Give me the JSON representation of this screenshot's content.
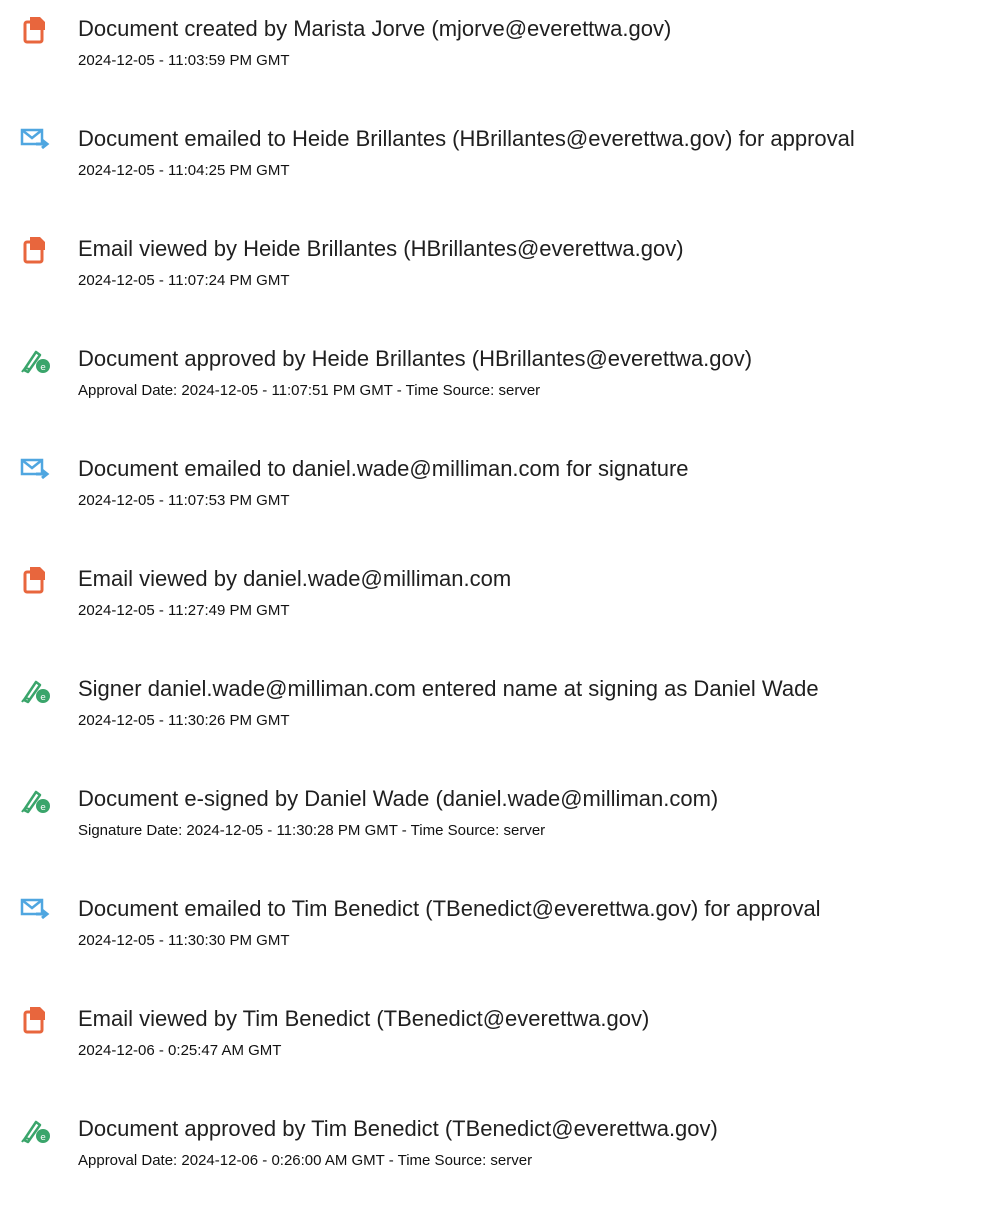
{
  "audit_trail": {
    "colors": {
      "doc_icon": "#e8663d",
      "email_icon": "#4fa6e0",
      "sign_icon": "#3aa56b"
    },
    "events": [
      {
        "icon": "document-icon",
        "title": "Document created by Marista Jorve (mjorve@everettwa.gov)",
        "meta": "2024-12-05 - 11:03:59 PM GMT"
      },
      {
        "icon": "email-sent-icon",
        "title": "Document emailed to Heide Brillantes (HBrillantes@everettwa.gov) for approval",
        "meta": "2024-12-05 - 11:04:25 PM GMT"
      },
      {
        "icon": "document-icon",
        "title": "Email viewed by Heide Brillantes (HBrillantes@everettwa.gov)",
        "meta": "2024-12-05 - 11:07:24 PM GMT"
      },
      {
        "icon": "e-sign-pen-icon",
        "title": "Document approved by Heide Brillantes (HBrillantes@everettwa.gov)",
        "meta": "Approval Date: 2024-12-05 - 11:07:51 PM GMT - Time Source: server"
      },
      {
        "icon": "email-sent-icon",
        "title": "Document emailed to daniel.wade@milliman.com for signature",
        "meta": "2024-12-05 - 11:07:53 PM GMT"
      },
      {
        "icon": "document-icon",
        "title": "Email viewed by daniel.wade@milliman.com",
        "meta": "2024-12-05 - 11:27:49 PM GMT"
      },
      {
        "icon": "e-sign-pen-icon",
        "title": "Signer daniel.wade@milliman.com entered name at signing as Daniel Wade",
        "meta": "2024-12-05 - 11:30:26 PM GMT"
      },
      {
        "icon": "e-sign-pen-icon",
        "title": "Document e-signed by Daniel Wade (daniel.wade@milliman.com)",
        "meta": "Signature Date: 2024-12-05 - 11:30:28 PM GMT - Time Source: server"
      },
      {
        "icon": "email-sent-icon",
        "title": "Document emailed to Tim Benedict (TBenedict@everettwa.gov) for approval",
        "meta": "2024-12-05 - 11:30:30 PM GMT"
      },
      {
        "icon": "document-icon",
        "title": "Email viewed by Tim Benedict (TBenedict@everettwa.gov)",
        "meta": "2024-12-06 - 0:25:47 AM GMT"
      },
      {
        "icon": "e-sign-pen-icon",
        "title": "Document approved by Tim Benedict (TBenedict@everettwa.gov)",
        "meta": "Approval Date: 2024-12-06 - 0:26:00 AM GMT - Time Source: server"
      }
    ]
  }
}
